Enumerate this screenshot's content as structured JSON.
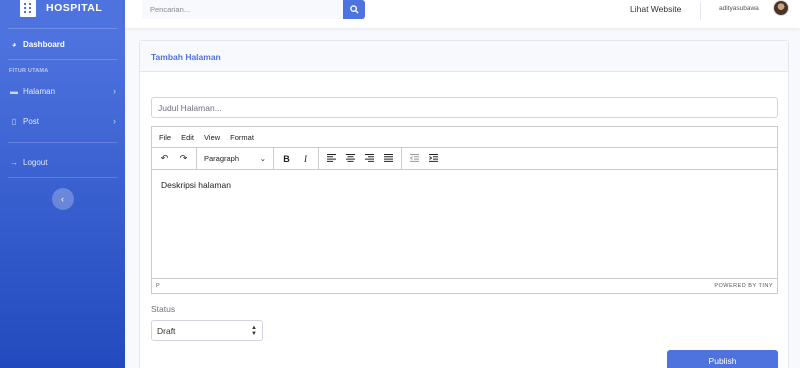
{
  "brand": {
    "name": "HOSPITAL"
  },
  "sidebar": {
    "dashboard": "Dashboard",
    "heading": "FITUR UTAMA",
    "items": [
      {
        "label": "Halaman"
      },
      {
        "label": "Post"
      }
    ],
    "logout": "Logout"
  },
  "topbar": {
    "search_placeholder": "Pencarian...",
    "view_site": "Lihat Website",
    "username": "adityasubawa"
  },
  "card": {
    "title": "Tambah Halaman",
    "title_placeholder": "Judul Halaman...",
    "editor": {
      "menus": [
        "File",
        "Edit",
        "View",
        "Format"
      ],
      "block_format": "Paragraph",
      "content": "Deskripsi halaman",
      "path": "P",
      "powered": "POWERED BY TINY"
    },
    "status_label": "Status",
    "status_value": "Draft",
    "publish_label": "Publish"
  }
}
